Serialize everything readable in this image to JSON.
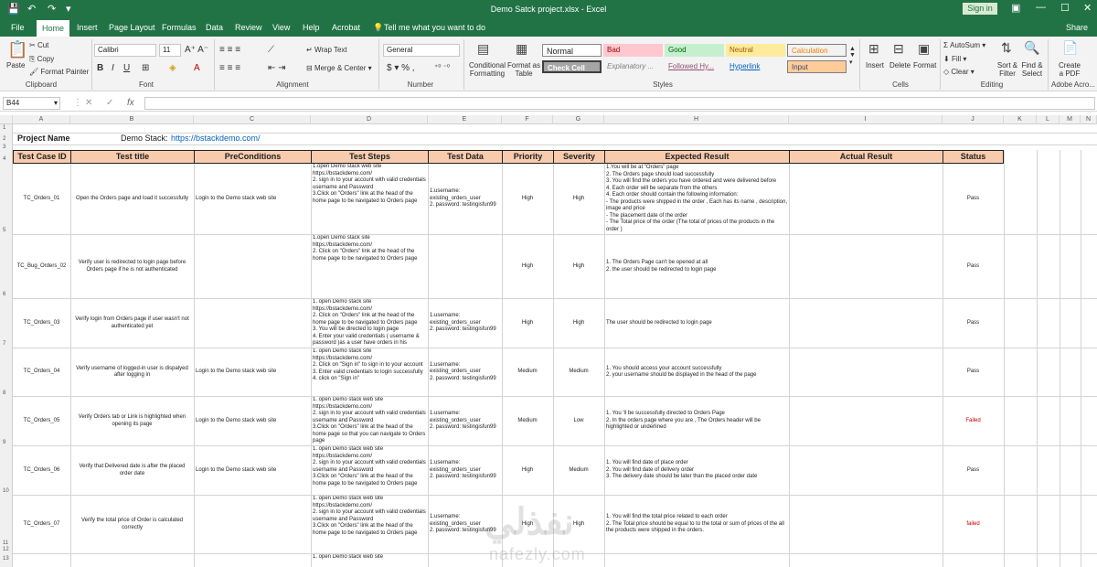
{
  "window": {
    "title": "Demo Satck project.xlsx  -  Excel",
    "signin": "Sign in"
  },
  "tabs": [
    "File",
    "Home",
    "Insert",
    "Page Layout",
    "Formulas",
    "Data",
    "Review",
    "View",
    "Help",
    "Acrobat",
    "Tell me what you want to do",
    "Share"
  ],
  "ribbon": {
    "clipboard": {
      "paste": "Paste",
      "cut": "Cut",
      "copy": "Copy",
      "format_painter": "Format Painter",
      "group": "Clipboard"
    },
    "font": {
      "name": "Calibri",
      "size": "11",
      "group": "Font"
    },
    "alignment": {
      "wrap": "Wrap Text",
      "merge": "Merge & Center",
      "group": "Alignment"
    },
    "number": {
      "format": "General",
      "group": "Number"
    },
    "styles": {
      "cond": "Conditional Formatting",
      "table": "Format as Table",
      "normal": "Normal",
      "bad": "Bad",
      "good": "Good",
      "neutral": "Neutral",
      "calculation": "Calculation",
      "check": "Check Cell",
      "explanatory": "Explanatory ...",
      "followed": "Followed Hy...",
      "hyperlink": "Hyperlink",
      "input": "Input",
      "group": "Styles"
    },
    "cells": {
      "insert": "Insert",
      "delete": "Delete",
      "format": "Format",
      "group": "Cells"
    },
    "editing": {
      "autosum": "AutoSum",
      "fill": "Fill",
      "clear": "Clear",
      "sort": "Sort & Filter",
      "find": "Find & Select",
      "group": "Editing"
    },
    "acrobat": {
      "create": "Create a PDF",
      "group": "Adobe Acro..."
    }
  },
  "formula_bar": {
    "namebox": "B44",
    "fx": "fx"
  },
  "columns": [
    "A",
    "B",
    "C",
    "D",
    "E",
    "F",
    "G",
    "H",
    "I",
    "J",
    "K",
    "L",
    "M",
    "N"
  ],
  "rows": [
    "1",
    "2",
    "3",
    "4",
    "5",
    "6",
    "7",
    "8",
    "9",
    "10",
    "11",
    "12",
    "13"
  ],
  "sheet": {
    "project_label": "Project Name",
    "demo_label": "Demo Stack:",
    "demo_url": "https://bstackdemo.com/",
    "headers": [
      "Test Case ID",
      "Test title",
      "PreConditions",
      "Test Steps",
      "Test Data",
      "Priority",
      "Severity",
      "Expected Result",
      "Actual Result",
      "Status"
    ],
    "rows": [
      {
        "id": "TC_Orders_01",
        "title": "Open the Orders page and load it successfully",
        "pre": "Login to the Demo stack web site",
        "steps": "1.open Demo stack web site https://bstackdemo.com/\n2. sign in to your account with valid credentials username and Password\n3.Click on \"Orders\" link at the head of the home page to be navigated to Orders page",
        "data": "1.username: existing_orders_user\n2. password: testingisfun99",
        "priority": "High",
        "severity": "High",
        "expected": "1.You will be at \"Orders\" page\n2. The Orders page should load successfully\n3. You will find the orders you have ordered and were delivered before\n4. Each order will be separate from the others\n4. Each order should contain the following information:\n  - The products were shipped in the order , Each has its name , description, image and   price\n  - The placement date of the order\n  - The Total price of the order (The total of prices of the products in the order )",
        "status": "Pass"
      },
      {
        "id": "TC_Bug_Orders_02",
        "title": "Verify user is redirected to login page before Orders page  if he is not authenticated",
        "pre": "",
        "steps": "1.open Demo stack  site https://bstackdemo.com/\n2. Click on \"Orders\" link at the head of the home page to be navigated to Orders page",
        "data": "",
        "priority": "High",
        "severity": "High",
        "expected": "1. The Orders Page can't be opened at all\n2. the user should be redirected to login page",
        "status": "Pass"
      },
      {
        "id": "TC_Orders_03",
        "title": "Verify login from Orders page if user wasn't not authenticated yet",
        "pre": "",
        "steps": "1. open Demo stack  site https://bstackdemo.com/\n2. Click on \"Orders\" link at the head of the home page to be navigated to Orders page\n3. You will be directed to login page\n4. Enter your valid credentials ( username & password )as a user have orders in his account",
        "data": "1.username: existing_orders_user\n2. password: testingisfun99",
        "priority": "High",
        "severity": "High",
        "expected": "The user should be redirected to login page",
        "status": "Pass"
      },
      {
        "id": "TC_Orders_04",
        "title": "Verify  username of logged-in user is dispalyed after logging in",
        "pre": "Login to the Demo stack web site",
        "steps": "1. open Demo stack  site https://bstackdemo.com/\n2. Click on \"Sign in\" to sign in to your account\n3. Enter valid credentials to login successfully\n4. click on \"Sign in\"",
        "data": "1.username: existing_orders_user\n2. password: testingisfun99",
        "priority": "Medium",
        "severity": "Medium",
        "expected": "1. You should access your account successfully\n2. your username should be displayed in the head of the page",
        "status": "Pass"
      },
      {
        "id": "TC_Orders_05",
        "title": "Verify Orders tab or Link is highlighted when opening its page",
        "pre": "Login to the Demo stack web site",
        "steps": "1. open Demo stack web site https://bstackdemo.com/\n2. sign in to your account with valid credentials username and Password\n3.Click on \"Orders\" link at the head of the home page so that you can navigate to Orders page",
        "data": "1.username: existing_orders_user\n2. password: testingisfun99",
        "priority": "Medium",
        "severity": "Low",
        "expected": "1. You 'll be successfully directed to Orders Page\n2. In the orders page where you are , The Orders header will be highlighted or underlined",
        "status": "Failed"
      },
      {
        "id": "TC_Orders_06",
        "title": "Verify that Delivered date is after the placed order date",
        "pre": "Login to the Demo stack web site",
        "steps": "1. open Demo stack web site https://bstackdemo.com/\n2. sign in to your account with valid credentials username and Password\n3.Click on \"Orders\" link at the head of the home page to be navigated to Orders page",
        "data": "1.username: existing_orders_user\n2. password: testingisfun99",
        "priority": "High",
        "severity": "Medium",
        "expected": "1. You will find date of place order\n2. You will find date of delivery order\n3. The delivery date should be later than the placed order date",
        "status": "Pass"
      },
      {
        "id": "TC_Orders_07",
        "title": "Verify the total price of Order is calculated correctly",
        "pre": "",
        "steps": "1. open Demo stack web site https://bstackdemo.com/\n2. sign in to your account with valid credentials username and Password\n3.Click on \"Orders\" link at the head of the home page to be navigated to Orders page",
        "data": "1.username: existing_orders_user\n2. password: testingisfun99",
        "priority": "High",
        "severity": "High",
        "expected": "1. You will find the total price related to each order\n2. The Total price should be equal to to the total or sum of prices of the all the products were shipped in the orders.",
        "status": "failed"
      },
      {
        "id": "",
        "title": "",
        "pre": "",
        "steps": "1. open Demo stack web site",
        "data": "",
        "priority": "",
        "severity": "",
        "expected": "",
        "status": ""
      }
    ]
  },
  "watermark": {
    "text": "nafezly.com",
    "arabic": "نفذلي"
  },
  "colors": {
    "excel_green": "#217346",
    "header_fill": "#f8cbad",
    "fail": "#c00000"
  }
}
